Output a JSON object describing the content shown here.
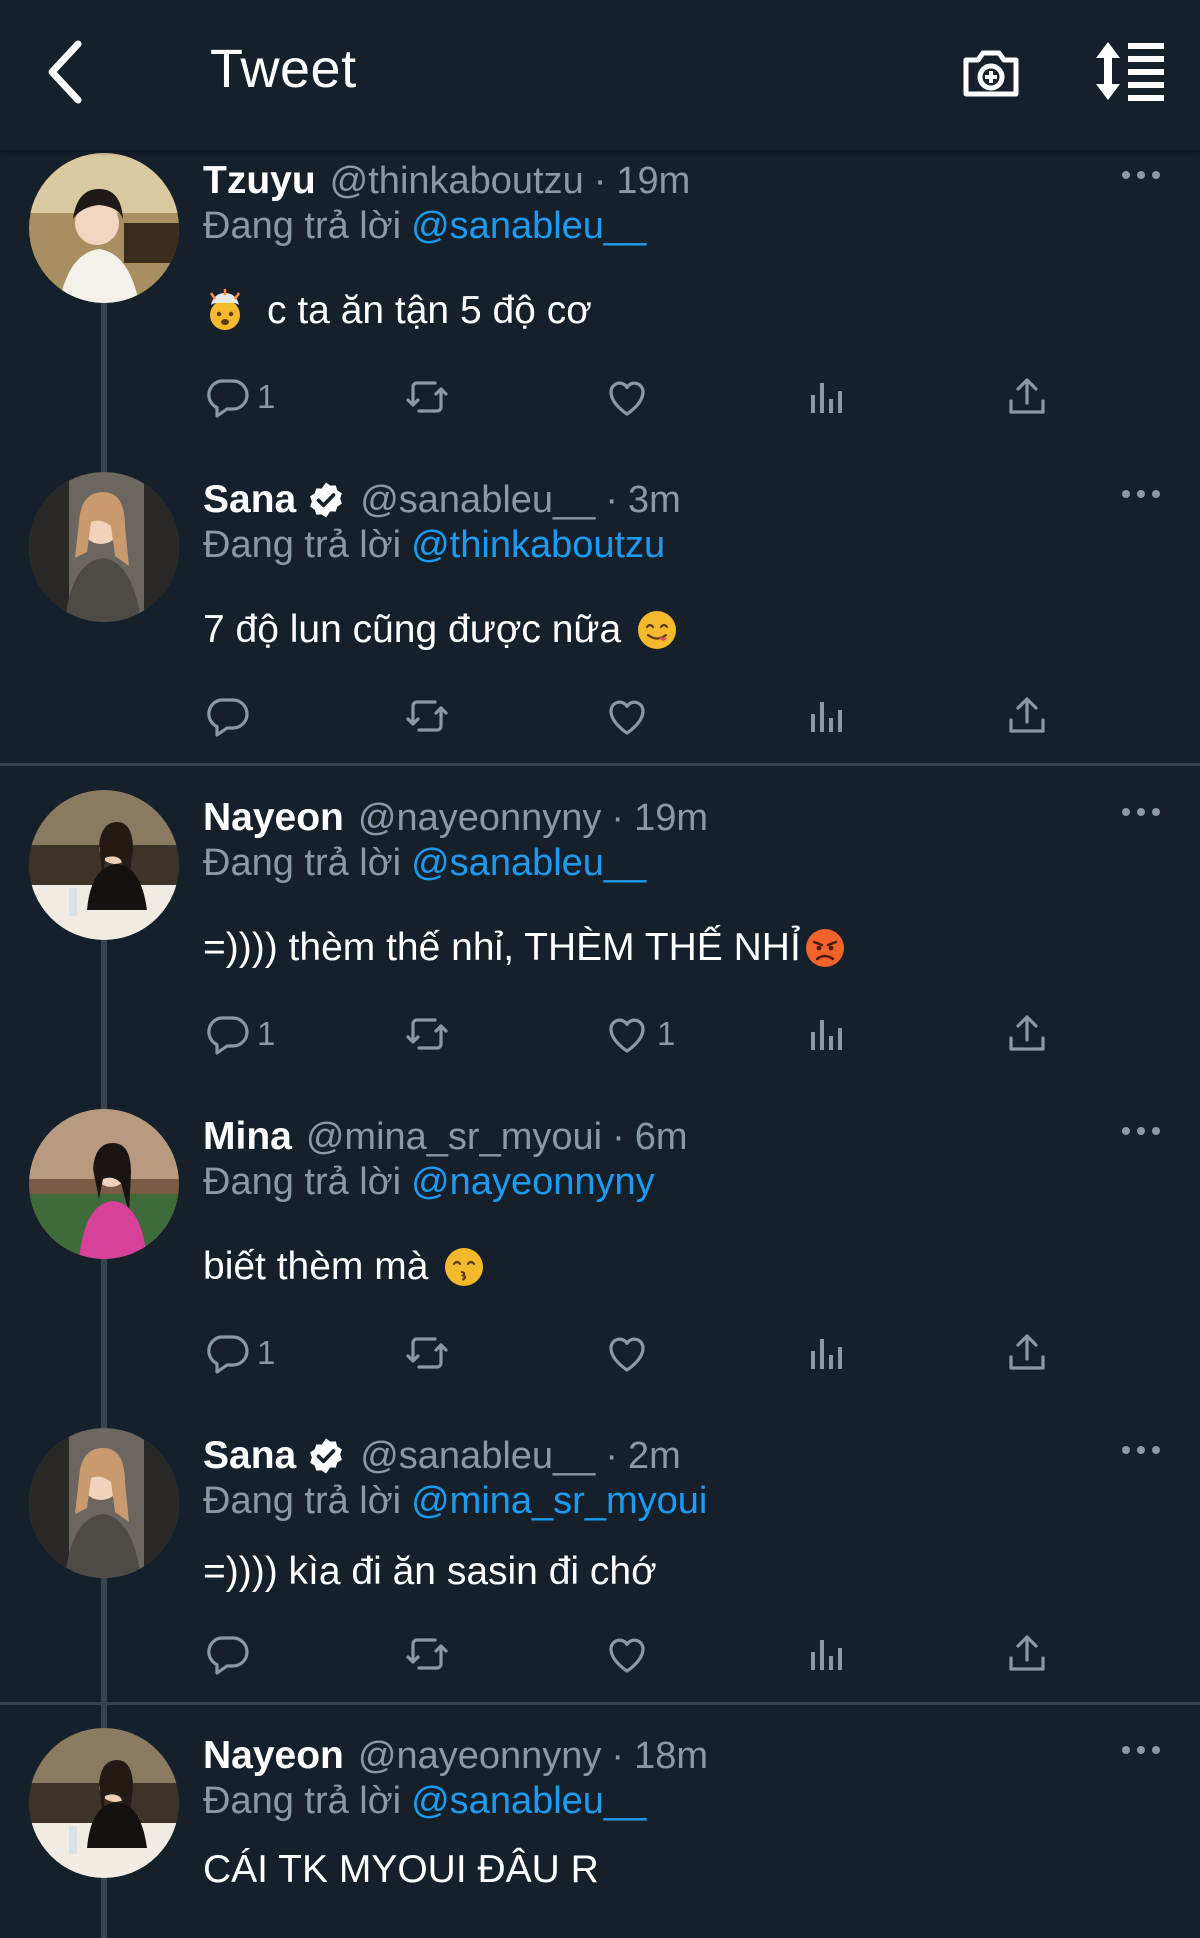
{
  "header": {
    "title": "Tweet"
  },
  "icons": {
    "back": "chevron-left-icon",
    "camera": "camera-plus-icon",
    "sort": "sort-list-icon",
    "more": "ellipsis-icon",
    "reply": "reply-icon",
    "retweet": "retweet-icon",
    "like": "heart-icon",
    "views": "analytics-icon",
    "share": "share-icon",
    "verified": "verified-badge-icon"
  },
  "colors": {
    "background": "#15202b",
    "mention": "#1d9bf0",
    "secondary_text": "#8b98a5",
    "divider": "#38444d"
  },
  "reply_prefix": "Đang trả lời",
  "tweets": [
    {
      "name": "Tzuyu",
      "handle": "@thinkaboutzu",
      "time": "19m",
      "verified": false,
      "reply_to": "@sanableu__",
      "text": "c ta ăn tận 5 độ cơ",
      "emoji": "exploding-head",
      "counts": {
        "reply": "1",
        "retweet": "",
        "like": ""
      }
    },
    {
      "name": "Sana",
      "handle": "@sanableu__",
      "time": "3m",
      "verified": true,
      "reply_to": "@thinkaboutzu",
      "text": "7 độ lun cũng được nữa",
      "emoji": "yum-face",
      "counts": {
        "reply": "",
        "retweet": "",
        "like": ""
      }
    },
    {
      "name": "Nayeon",
      "handle": "@nayeonnyny",
      "time": "19m",
      "verified": false,
      "reply_to": "@sanableu__",
      "text": "=)))) thèm thế nhỉ, THÈM THẾ NHỈ",
      "emoji": "angry-face",
      "counts": {
        "reply": "1",
        "retweet": "",
        "like": "1"
      }
    },
    {
      "name": "Mina",
      "handle": "@mina_sr_myoui",
      "time": "6m",
      "verified": false,
      "reply_to": "@nayeonnyny",
      "text": "biết thèm mà",
      "emoji": "kissing-face",
      "counts": {
        "reply": "1",
        "retweet": "",
        "like": ""
      }
    },
    {
      "name": "Sana",
      "handle": "@sanableu__",
      "time": "2m",
      "verified": true,
      "reply_to": "@mina_sr_myoui",
      "text": "=)))) kìa đi ăn sasin đi chớ",
      "emoji": "",
      "counts": {
        "reply": "",
        "retweet": "",
        "like": ""
      }
    },
    {
      "name": "Nayeon",
      "handle": "@nayeonnyny",
      "time": "18m",
      "verified": false,
      "reply_to": "@sanableu__",
      "text": "CÁI TK MYOUI ĐÂU R",
      "emoji": "",
      "counts": {
        "reply": "",
        "retweet": "",
        "like": ""
      }
    }
  ]
}
